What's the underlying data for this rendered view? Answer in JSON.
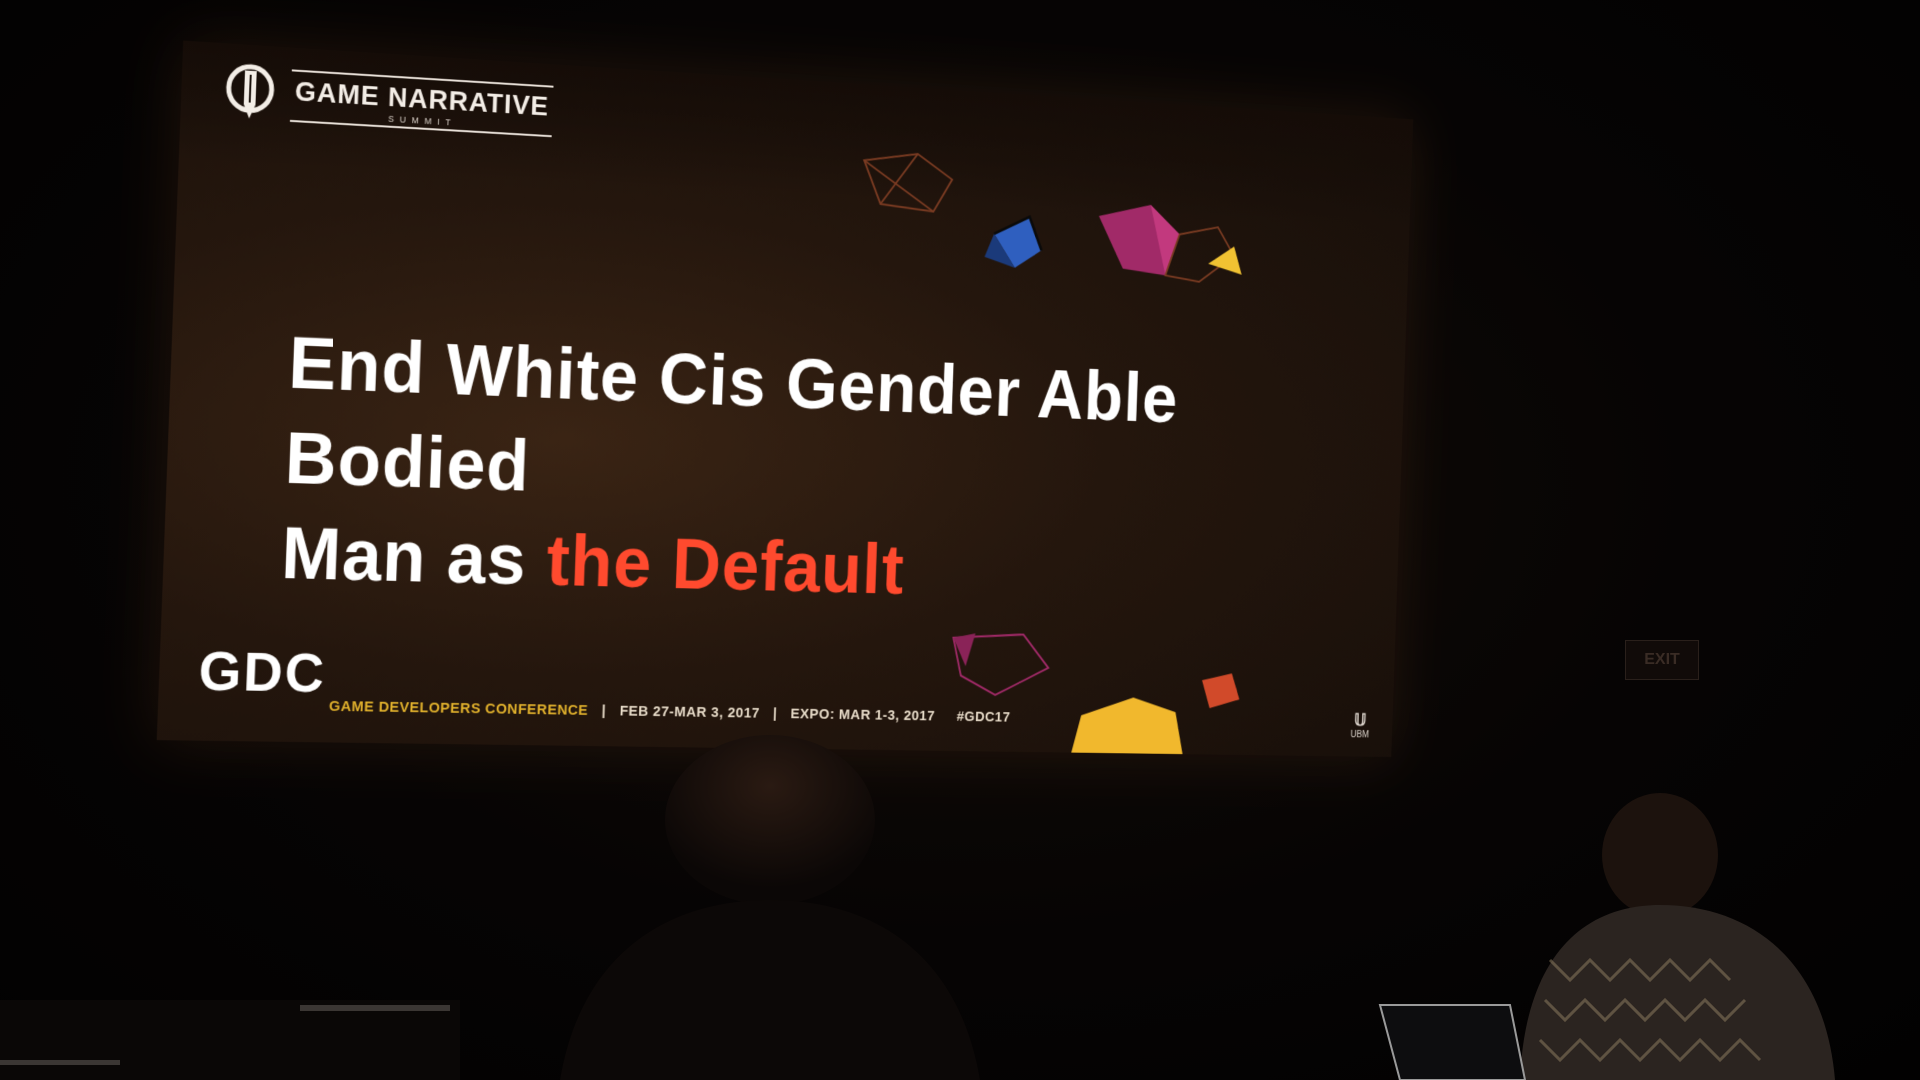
{
  "slide": {
    "summit_title": "GAME NARRATIVE",
    "summit_subtitle": "SUMMIT",
    "headline_line1": "End White Cis Gender Able Bodied",
    "headline_line2_white": "Man as ",
    "headline_line2_accent": "the Default",
    "gdc_logo": "GDC",
    "conference_name": "GAME DEVELOPERS CONFERENCE",
    "conference_dates": "FEB 27-MAR 3, 2017",
    "expo_dates": "EXPO: MAR 1-3, 2017",
    "hashtag": "#GDC17",
    "sponsor": "UBM"
  },
  "room": {
    "exit_sign": "EXIT"
  },
  "colors": {
    "accent_red": "#ff4a2e",
    "gold": "#e1b12c",
    "slide_bg": "#24160d"
  },
  "icons": [
    "pen-nib-icon",
    "gem-shapes"
  ]
}
